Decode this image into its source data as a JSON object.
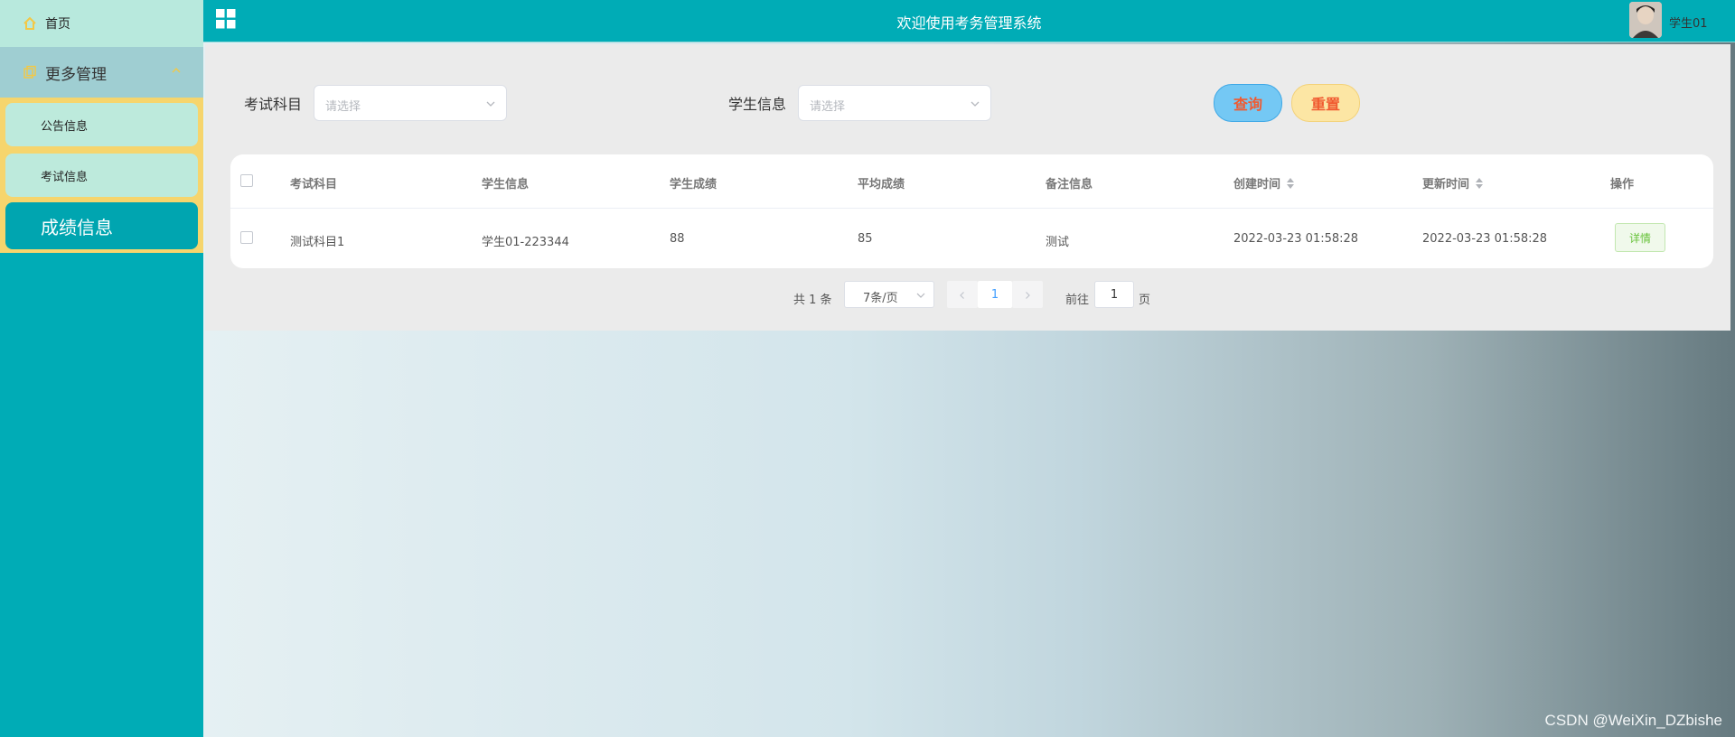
{
  "sidebar": {
    "home_label": "首页",
    "group_label": "更多管理",
    "items": [
      {
        "label": "公告信息"
      },
      {
        "label": "考试信息"
      },
      {
        "label": "成绩信息"
      }
    ]
  },
  "header": {
    "title": "欢迎使用考务管理系统",
    "username": "学生01"
  },
  "search": {
    "subject_label": "考试科目",
    "subject_placeholder": "请选择",
    "student_label": "学生信息",
    "student_placeholder": "请选择",
    "query_label": "查询",
    "reset_label": "重置"
  },
  "table": {
    "columns": [
      "考试科目",
      "学生信息",
      "学生成绩",
      "平均成绩",
      "备注信息",
      "创建时间",
      "更新时间",
      "操作"
    ],
    "rows": [
      {
        "subject": "测试科目1",
        "student": "学生01-223344",
        "score": "88",
        "average": "85",
        "remark": "测试",
        "created": "2022-03-23 01:58:28",
        "updated": "2022-03-23 01:58:28",
        "action": "详情"
      }
    ]
  },
  "pagination": {
    "total": "共 1 条",
    "page_size": "7条/页",
    "current": "1",
    "goto_label": "前往",
    "goto_value": "1",
    "page_suffix": "页"
  },
  "watermark": "CSDN @WeiXin_DZbishe",
  "colors": {
    "primary": "#00acb6",
    "submenu_bg": "#f6d56d",
    "query_bg": "#74c8f4",
    "reset_bg": "#fce6a4",
    "button_text": "#f05a30"
  }
}
